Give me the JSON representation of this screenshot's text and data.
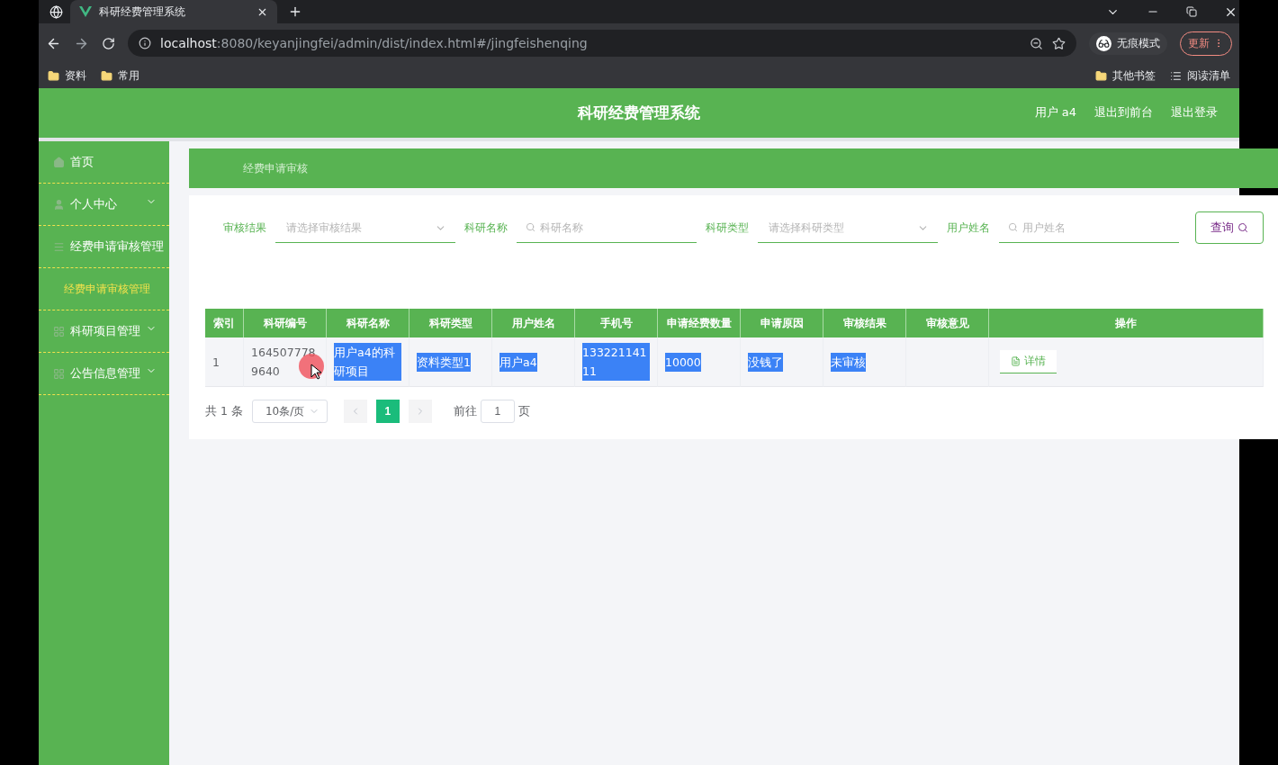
{
  "browser": {
    "tab_title": "科研经费管理系统",
    "url_host": "localhost",
    "url_rest": ":8080/keyanjingfei/admin/dist/index.html#/jingfeishenqing",
    "profile": "无痕模式",
    "update": "更新",
    "bookmarks": [
      "资料",
      "常用"
    ],
    "other_bookmarks": "其他书签",
    "reading_list": "阅读清单"
  },
  "header": {
    "title": "科研经费管理系统",
    "links": [
      "用户 a4",
      "退出到前台",
      "退出登录"
    ]
  },
  "sidebar": {
    "items": [
      {
        "label": "首页",
        "kind": "home"
      },
      {
        "label": "个人中心",
        "kind": "user"
      },
      {
        "label": "经费申请审核管理",
        "kind": "menu",
        "children": [
          {
            "label": "经费申请审核管理",
            "selected": true
          }
        ]
      },
      {
        "label": "科研项目管理",
        "kind": "grid"
      },
      {
        "label": "公告信息管理",
        "kind": "grid"
      }
    ]
  },
  "breadcrumb": "经费申请审核",
  "filters": [
    {
      "label": "审核结果",
      "kind": "select",
      "placeholder": "请选择审核结果"
    },
    {
      "label": "科研名称",
      "kind": "search",
      "placeholder": "科研名称"
    },
    {
      "label": "科研类型",
      "kind": "select",
      "placeholder": "请选择科研类型"
    },
    {
      "label": "用户姓名",
      "kind": "search",
      "placeholder": "用户姓名"
    }
  ],
  "query_button": "查询",
  "table": {
    "columns": [
      "索引",
      "科研编号",
      "科研名称",
      "科研类型",
      "用户姓名",
      "手机号",
      "申请经费数量",
      "申请原因",
      "审核结果",
      "审核意见",
      "操作"
    ],
    "rows": [
      {
        "cells": [
          {
            "text": "1",
            "highlighted": false
          },
          {
            "text": "1645077789640",
            "highlighted": false
          },
          {
            "text": "用户a4的科研项目",
            "highlighted": true
          },
          {
            "text": "资料类型1",
            "highlighted": true
          },
          {
            "text": "用户a4",
            "highlighted": true
          },
          {
            "text": "13322114111",
            "highlighted": true
          },
          {
            "text": "10000",
            "highlighted": true
          },
          {
            "text": "没钱了",
            "highlighted": true
          },
          {
            "text": "未审核",
            "highlighted": true
          },
          {
            "text": ""
          }
        ],
        "action": "详情"
      }
    ]
  },
  "pagination": {
    "total": "共 1 条",
    "page_size": "10条/页",
    "pages": [
      {
        "label": "1",
        "selected": true
      }
    ],
    "goto_label": "前往",
    "goto_value": "1",
    "goto_suffix": "页"
  }
}
